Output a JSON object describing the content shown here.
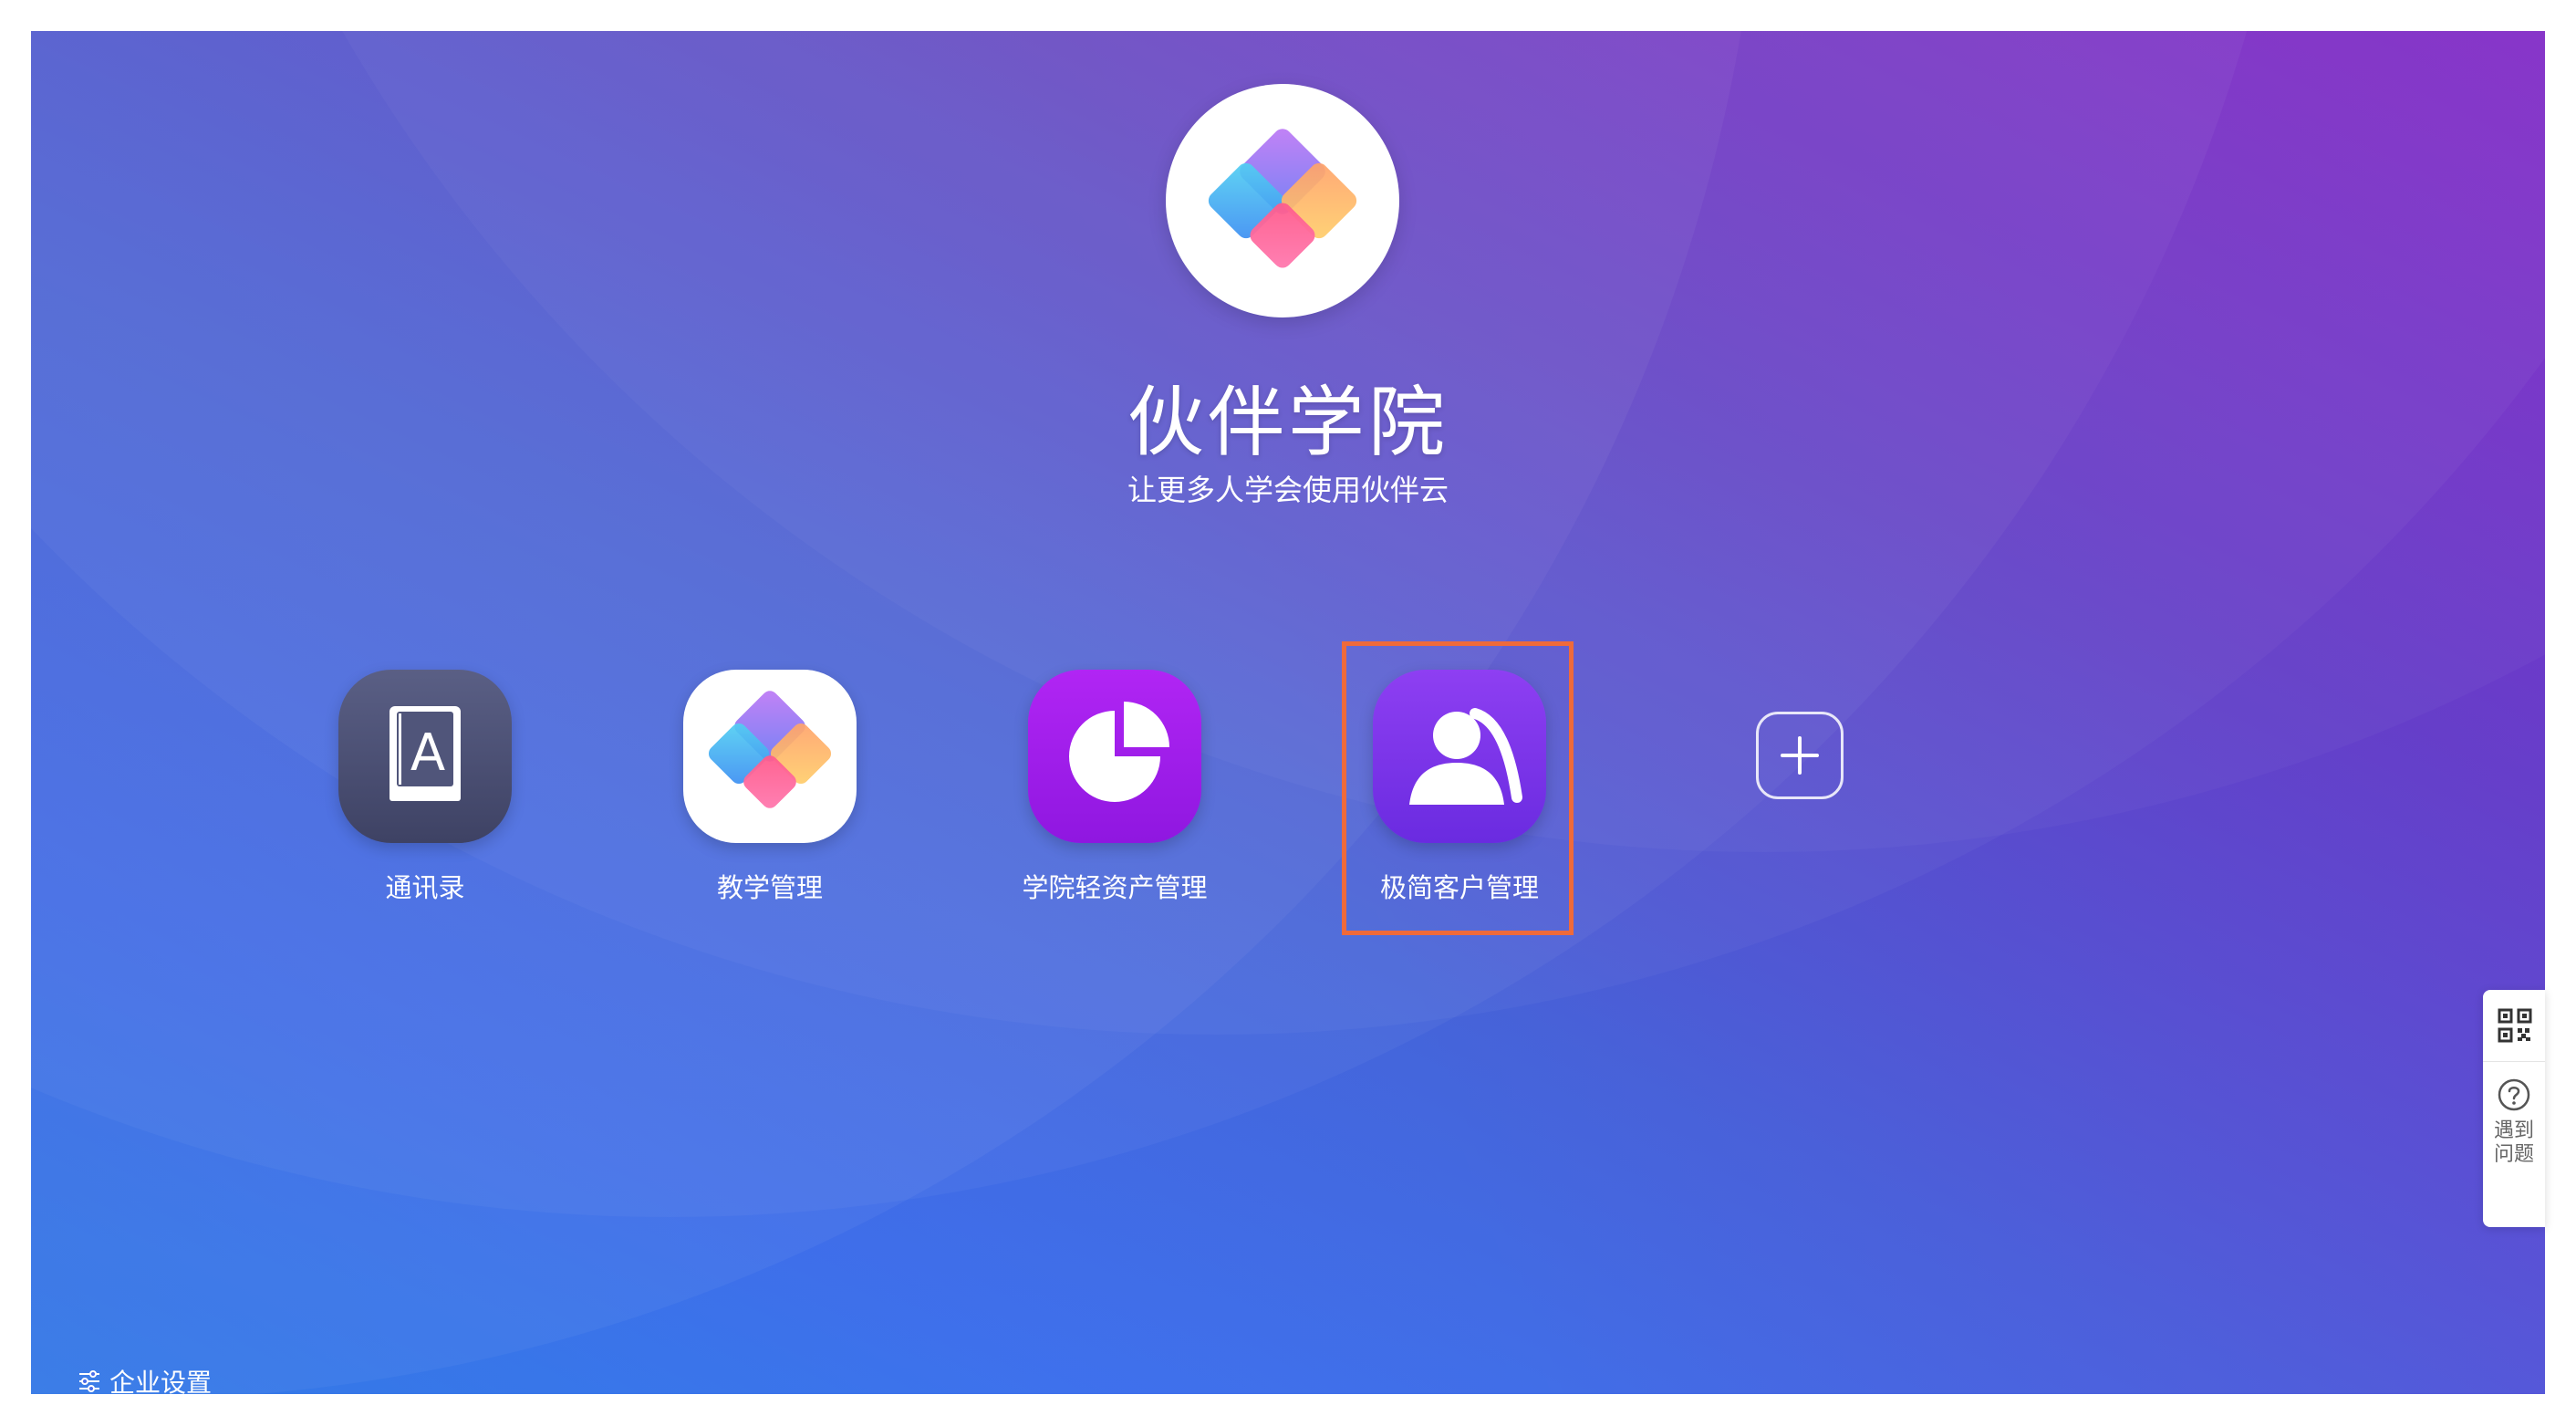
{
  "header": {
    "title": "伙伴学院",
    "subtitle": "让更多人学会使用伙伴云",
    "logo_icon": "partner-cloud-logo-icon"
  },
  "apps": [
    {
      "label": "通讯录",
      "icon": "contacts-book-icon"
    },
    {
      "label": "教学管理",
      "icon": "partner-cloud-logo-icon"
    },
    {
      "label": "学院轻资产管理",
      "icon": "pie-chart-icon"
    },
    {
      "label": "极简客户管理",
      "icon": "users-icon"
    }
  ],
  "add_app": {
    "icon": "plus-icon"
  },
  "side_panel": {
    "qr_icon": "qr-code-icon",
    "help_icon": "question-icon",
    "help_line1": "遇到",
    "help_line2": "问题"
  },
  "footer": {
    "settings_label": "企业设置",
    "settings_icon": "sliders-icon"
  },
  "colors": {
    "highlight": "#ef6a3a",
    "background_start": "#7a22b8",
    "background_end": "#2f8ef6"
  }
}
